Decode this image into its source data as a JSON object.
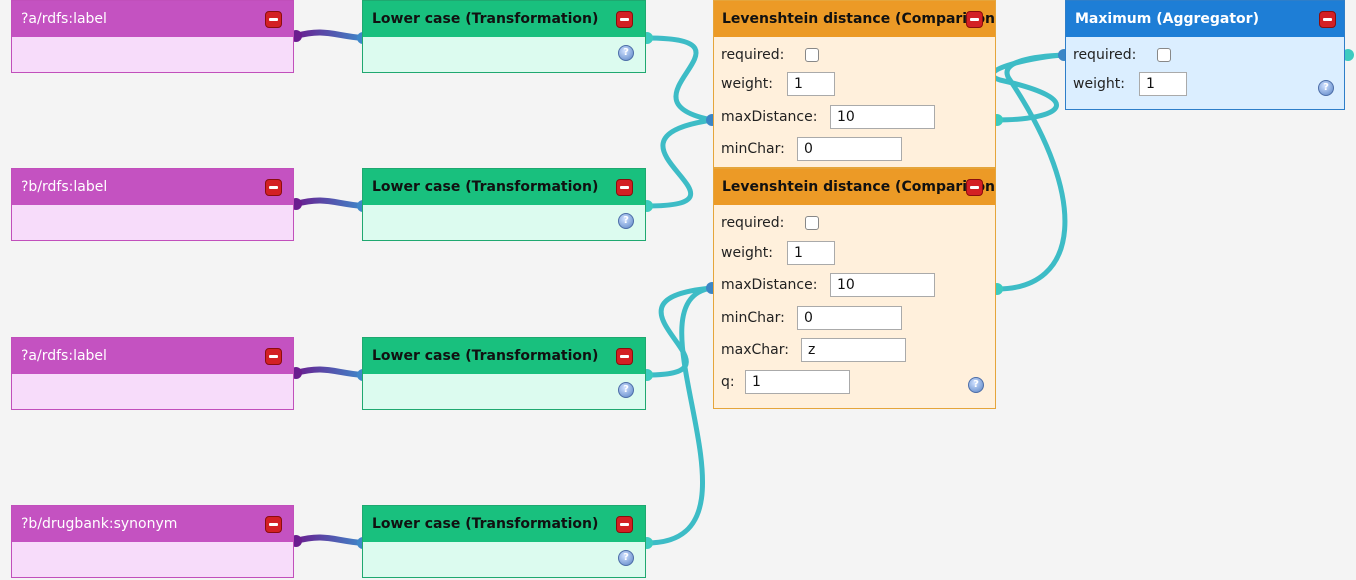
{
  "sources": [
    {
      "label": "?a/rdfs:label"
    },
    {
      "label": "?b/rdfs:label"
    },
    {
      "label": "?a/rdfs:label"
    },
    {
      "label": "?b/drugbank:synonym"
    }
  ],
  "transforms": [
    {
      "label": "Lower case (Transformation)"
    },
    {
      "label": "Lower case (Transformation)"
    },
    {
      "label": "Lower case (Transformation)"
    },
    {
      "label": "Lower case (Transformation)"
    }
  ],
  "comparisons": [
    {
      "label": "Levenshtein distance (Comparison)",
      "required_label": "required:",
      "weight_label": "weight:",
      "weight": "1",
      "maxDistance_label": "maxDistance:",
      "maxDistance": "10",
      "minChar_label": "minChar:",
      "minChar": "0"
    },
    {
      "label": "Levenshtein distance (Comparison)",
      "required_label": "required:",
      "weight_label": "weight:",
      "weight": "1",
      "maxDistance_label": "maxDistance:",
      "maxDistance": "10",
      "minChar_label": "minChar:",
      "minChar": "0",
      "maxChar_label": "maxChar:",
      "maxChar": "z",
      "q_label": "q:",
      "q": "1"
    }
  ],
  "aggregator": {
    "label": "Maximum (Aggregator)",
    "required_label": "required:",
    "weight_label": "weight:",
    "weight": "1"
  },
  "icons": {
    "remove": "remove-icon",
    "help": "help-icon"
  },
  "colors": {
    "source": "#c452c1",
    "transform": "#19c07e",
    "comparison": "#ec9a26",
    "aggregator": "#1e7ed6",
    "wire_source": "#7b2fa0",
    "wire": "#3dbcc6"
  }
}
